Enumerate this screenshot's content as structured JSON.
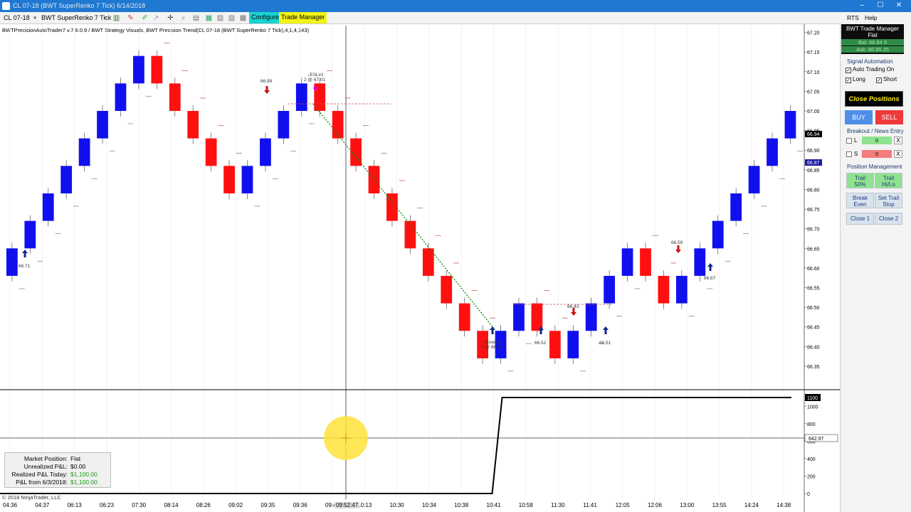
{
  "window": {
    "title": "CL 07-18 (BWT SuperRenko 7 Tick)  6/14/2018",
    "controls": [
      "–",
      "☐",
      "✕"
    ]
  },
  "toolbar": {
    "instrument": "CL 07-18",
    "bar_type": "BWT SuperRenko 7 Tick",
    "configure": "Configure",
    "trade_manager": "Trade Manager"
  },
  "indicator_line": "BWTPrecisionAutoTrader7 v.7.6.0.9 / BWT Strategy Visuals, BWT Precision Trend(CL 07-18 (BWT SuperRenko 7 Tick),4,1,4,143)",
  "menu": {
    "rts": "RTS",
    "help": "Help"
  },
  "trade_manager_panel": {
    "title": "BWT Trade Manager",
    "position": "Flat",
    "bid": "Bid: 66.94 9",
    "ask": "Ask: 66.95 25",
    "signal_automation_label": "Signal Automation",
    "auto_trading": "Auto Trading On",
    "long": "Long",
    "short": "Short",
    "close_positions": "Close Positions",
    "buy": "BUY",
    "sell": "SELL",
    "breakout_label": "Breakout / News Entry",
    "long_letter": "L",
    "short_letter": "S",
    "long_value": "0",
    "short_value": "0",
    "clear": "X",
    "position_management_label": "Position Management",
    "trail_50_a": "Trail",
    "trail_50_b": "50%",
    "trail_hilo_a": "Trail",
    "trail_hilo_b": "Hi/Lo",
    "break_even_a": "Break",
    "break_even_b": "Even",
    "set_trail_a": "Set Trail",
    "set_trail_b": "Stop",
    "close1": "Close 1",
    "close2": "Close 2"
  },
  "status": {
    "market_position_label": "Market Position:",
    "market_position": "Flat",
    "unrealized_label": "Unrealized P&L:",
    "unrealized": "$0.00",
    "realized_today_label": "Realized P&L Today:",
    "realized_today": "$1,100.00",
    "pl_from_label": "P&L from 6/3/2018:",
    "pl_from": "$1,100.00"
  },
  "copyright": "© 2018 NinjaTrader, LLC",
  "annotations": {
    "esl_a": "↓ESL#1",
    "esl_b": "2 @ 67.01",
    "close_a": "↑Close#1",
    "close_b": "2 @ 66.46",
    "p6671": "66.71",
    "p6699": "66.99",
    "p6652": "66.52",
    "p6643": "66.43",
    "p6651": "66.51",
    "p6659": "66.59",
    "p6667": "66.67"
  },
  "price_axis": {
    "labels": [
      "67.20",
      "67.15",
      "67.10",
      "67.05",
      "67.00",
      "66.95",
      "66.90",
      "66.85",
      "66.80",
      "66.75",
      "66.70",
      "66.65",
      "66.60",
      "66.55",
      "66.50",
      "66.45",
      "66.40",
      "66.35"
    ],
    "marker_current": "66.94",
    "marker_blue": "66.87"
  },
  "pnl_axis": {
    "labels": [
      "1000",
      "800",
      "600",
      "400",
      "200",
      "0"
    ],
    "marker_top": "1100",
    "marker_cross": "642.97"
  },
  "time_axis": [
    "04:36",
    "04:37",
    "06:13",
    "06:23",
    "07:30",
    "08:14",
    "08:26",
    "09:02",
    "09:35",
    "09:36",
    "09:42",
    "10:13",
    "10:30",
    "10:34",
    "10:38",
    "10:41",
    "10:58",
    "11:30",
    "11:41",
    "12:05",
    "12:06",
    "13:00",
    "13:55",
    "14:24",
    "14:38"
  ],
  "crosshair_time": "09:52:47",
  "colors": {
    "up": "#1010ee",
    "down": "#ff1010",
    "configure": "#19d3d0",
    "trade_manager": "#f3f316"
  },
  "chart_data": {
    "type": "renko",
    "brick_size": 0.07,
    "ylim": [
      66.33,
      67.21
    ],
    "bricks": [
      {
        "o": 66.58,
        "c": 66.65
      },
      {
        "o": 66.65,
        "c": 66.72
      },
      {
        "o": 66.72,
        "c": 66.79
      },
      {
        "o": 66.79,
        "c": 66.86
      },
      {
        "o": 66.86,
        "c": 66.93
      },
      {
        "o": 66.93,
        "c": 67.0
      },
      {
        "o": 67.0,
        "c": 67.07
      },
      {
        "o": 67.07,
        "c": 67.14
      },
      {
        "o": 67.14,
        "c": 67.07
      },
      {
        "o": 67.07,
        "c": 67.0
      },
      {
        "o": 67.0,
        "c": 66.93
      },
      {
        "o": 66.93,
        "c": 66.86
      },
      {
        "o": 66.86,
        "c": 66.79
      },
      {
        "o": 66.79,
        "c": 66.86
      },
      {
        "o": 66.86,
        "c": 66.93
      },
      {
        "o": 66.93,
        "c": 67.0
      },
      {
        "o": 67.0,
        "c": 67.07
      },
      {
        "o": 67.07,
        "c": 67.0
      },
      {
        "o": 67.0,
        "c": 66.93
      },
      {
        "o": 66.93,
        "c": 66.86
      },
      {
        "o": 66.86,
        "c": 66.79
      },
      {
        "o": 66.79,
        "c": 66.72
      },
      {
        "o": 66.72,
        "c": 66.65
      },
      {
        "o": 66.65,
        "c": 66.58
      },
      {
        "o": 66.58,
        "c": 66.51
      },
      {
        "o": 66.51,
        "c": 66.44
      },
      {
        "o": 66.44,
        "c": 66.37
      },
      {
        "o": 66.37,
        "c": 66.44
      },
      {
        "o": 66.44,
        "c": 66.51
      },
      {
        "o": 66.51,
        "c": 66.44
      },
      {
        "o": 66.44,
        "c": 66.37
      },
      {
        "o": 66.37,
        "c": 66.44
      },
      {
        "o": 66.44,
        "c": 66.51
      },
      {
        "o": 66.51,
        "c": 66.58
      },
      {
        "o": 66.58,
        "c": 66.65
      },
      {
        "o": 66.65,
        "c": 66.58
      },
      {
        "o": 66.58,
        "c": 66.51
      },
      {
        "o": 66.51,
        "c": 66.58
      },
      {
        "o": 66.58,
        "c": 66.65
      },
      {
        "o": 66.65,
        "c": 66.72
      },
      {
        "o": 66.72,
        "c": 66.79
      },
      {
        "o": 66.79,
        "c": 66.86
      },
      {
        "o": 66.86,
        "c": 66.93
      },
      {
        "o": 66.93,
        "c": 67.0
      }
    ],
    "pnl_series": {
      "x_switch": "10:41",
      "before": 0,
      "after": 1100
    },
    "pnl_ylim": [
      0,
      1100
    ]
  }
}
